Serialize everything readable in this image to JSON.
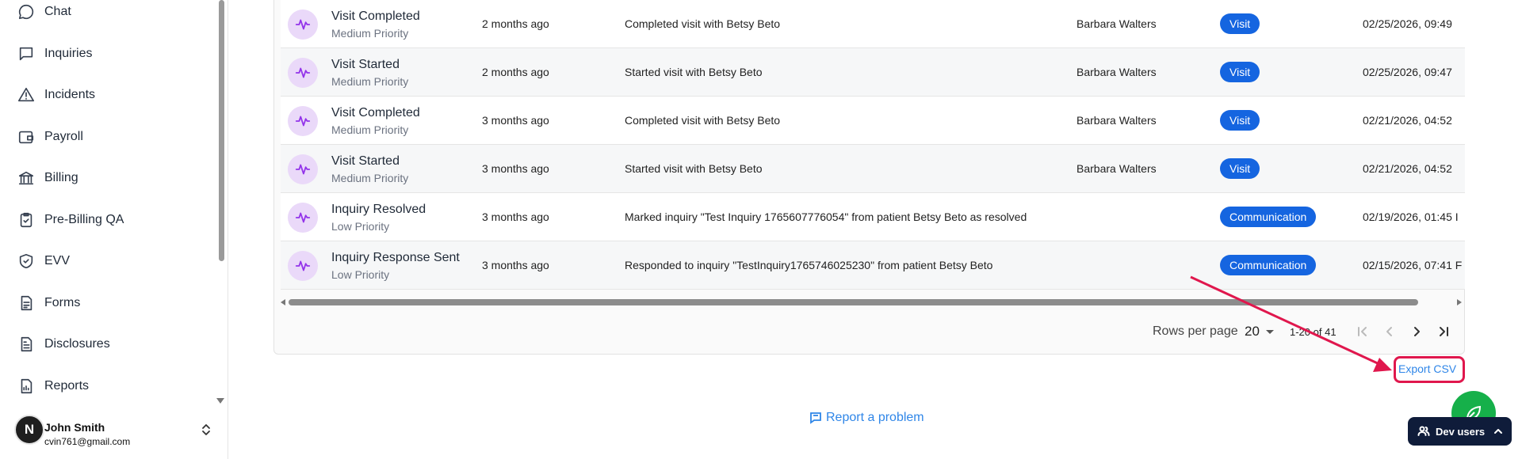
{
  "sidebar": {
    "items": [
      {
        "label": "Chat",
        "icon": "chat-bubble-icon"
      },
      {
        "label": "Inquiries",
        "icon": "message-square-icon"
      },
      {
        "label": "Incidents",
        "icon": "warning-triangle-icon"
      },
      {
        "label": "Payroll",
        "icon": "wallet-icon"
      },
      {
        "label": "Billing",
        "icon": "bank-icon"
      },
      {
        "label": "Pre-Billing QA",
        "icon": "clipboard-check-icon"
      },
      {
        "label": "EVV",
        "icon": "shield-check-icon"
      },
      {
        "label": "Forms",
        "icon": "document-icon"
      },
      {
        "label": "Disclosures",
        "icon": "document-list-icon"
      },
      {
        "label": "Reports",
        "icon": "report-icon"
      }
    ],
    "user": {
      "avatar_initial": "N",
      "name": "John Smith",
      "email": "cvin761@gmail.com"
    }
  },
  "activity": {
    "rows": [
      {
        "title": "Visit Completed",
        "priority": "Medium Priority",
        "time": "2 months ago",
        "description": "Completed visit with Betsy Beto",
        "user": "Barbara Walters",
        "category": "Visit",
        "date": "02/25/2026, 09:49"
      },
      {
        "title": "Visit Started",
        "priority": "Medium Priority",
        "time": "2 months ago",
        "description": "Started visit with Betsy Beto",
        "user": "Barbara Walters",
        "category": "Visit",
        "date": "02/25/2026, 09:47"
      },
      {
        "title": "Visit Completed",
        "priority": "Medium Priority",
        "time": "3 months ago",
        "description": "Completed visit with Betsy Beto",
        "user": "Barbara Walters",
        "category": "Visit",
        "date": "02/21/2026, 04:52"
      },
      {
        "title": "Visit Started",
        "priority": "Medium Priority",
        "time": "3 months ago",
        "description": "Started visit with Betsy Beto",
        "user": "Barbara Walters",
        "category": "Visit",
        "date": "02/21/2026, 04:52"
      },
      {
        "title": "Inquiry Resolved",
        "priority": "Low Priority",
        "time": "3 months ago",
        "description": "Marked inquiry \"Test Inquiry 1765607776054\" from patient Betsy Beto as resolved",
        "user": "",
        "category": "Communication",
        "date": "02/19/2026, 01:45 I"
      },
      {
        "title": "Inquiry Response Sent",
        "priority": "Low Priority",
        "time": "3 months ago",
        "description": "Responded to inquiry \"TestInquiry1765746025230\" from patient Betsy Beto",
        "user": "",
        "category": "Communication",
        "date": "02/15/2026, 07:41 F"
      }
    ]
  },
  "pagination": {
    "rows_per_page_label": "Rows per page",
    "rows_per_page_value": "20",
    "range": "1-20 of 41"
  },
  "actions": {
    "export_csv": "Export CSV",
    "report_problem": "Report a problem",
    "dev_users": "Dev users"
  },
  "colors": {
    "badge": "#1565e0",
    "link": "#2f86e8",
    "highlight": "#e0174d",
    "fab": "#16b04a",
    "dev_users_bg": "#0f1c3a",
    "activity_icon": "#9333ea"
  }
}
